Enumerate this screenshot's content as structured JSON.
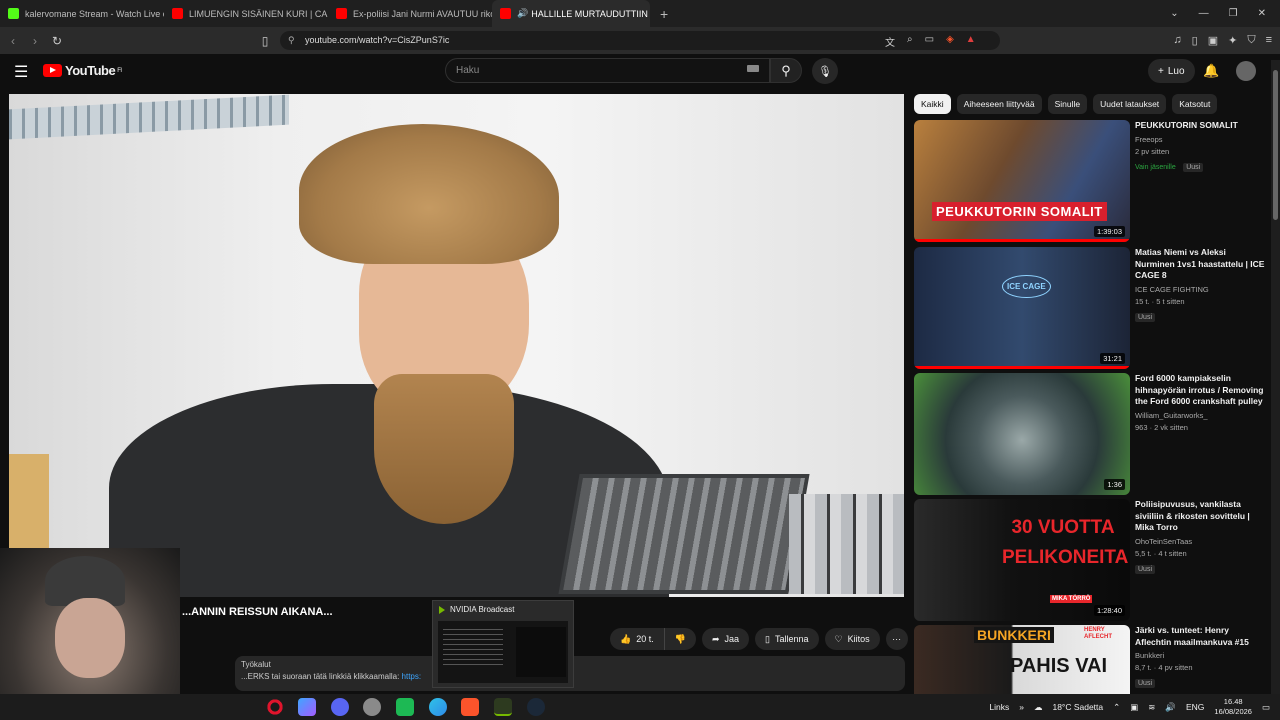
{
  "browser": {
    "tabs": [
      {
        "title": "kalervomane Stream - Watch Live on",
        "color": "#53fc18"
      },
      {
        "title": "LIMUENGIN SISÄINEN KURI | CANNO",
        "color": "#ff0000"
      },
      {
        "title": "Ex-poliisi Jani Nurmi AVAUTUU rikolli",
        "color": "#ff0000"
      },
      {
        "title": "HALLILLE MURTAUDUTTIIN ...",
        "color": "#ff0000",
        "active": true
      }
    ],
    "new_tab": "+",
    "url": "youtube.com/watch?v=CisZPunS7ic"
  },
  "youtube": {
    "logo_text": "YouTube",
    "logo_sup": "FI",
    "search_placeholder": "Haku",
    "create_label": "Luo",
    "video_title": "...ANNIN REISSUN AIKANA...",
    "actions": {
      "likes": "20 t.",
      "share": "Jaa",
      "save": "Tallenna",
      "thanks": "Kiitos",
      "more": "···"
    },
    "description_line1": "Työkalut",
    "description_line2": "...ERKS tai suoraan tätä linkkiä klikkaamalla:",
    "description_link": "https:",
    "chips": [
      "Kaikki",
      "Aiheeseen liittyvää",
      "Sinulle",
      "Uudet lataukset",
      "Katsotut"
    ],
    "recommendations": [
      {
        "title": "PEUKKUTORIN SOMALIT",
        "channel": "Freeops",
        "stats": "2 pv sitten",
        "badges": [
          "Vain jäsenille",
          "Uusi"
        ],
        "duration": "1:39:03",
        "thumb_caption": "PEUKKUTORIN SOMALIT",
        "progress": 1.0
      },
      {
        "title": "Matias Niemi vs Aleksi Nurminen 1vs1 haastattelu | ICE CAGE 8",
        "channel": "ICE CAGE FIGHTING",
        "stats": "15 t. · 5 t sitten",
        "badges": [
          "Uusi"
        ],
        "duration": "31:21",
        "thumb_caption": "ICE CAGE",
        "progress": 1.0
      },
      {
        "title": "Ford 6000 kampiakselin hihnapyörän irrotus / Removing the Ford 6000 crankshaft pulley",
        "channel": "William_Guitarworks_",
        "stats": "963 · 2 vk sitten",
        "badges": [],
        "duration": "1:36",
        "thumb_caption": "",
        "progress": 0
      },
      {
        "title": "Poliisipuvusus, vankilasta siviiliin & rikosten sovittelu | Mika Torro",
        "channel": "OhoTeinSenTaas",
        "stats": "5,5 t. · 4 t sitten",
        "badges": [
          "Uusi"
        ],
        "duration": "1:28:40",
        "thumb_caption": "30 VUOTTA PELIKONEITA",
        "thumb_sub": "MIKA TÖRRÖ",
        "progress": 0
      },
      {
        "title": "Järki vs. tunteet: Henry Aflechtin maailmankuva #15",
        "channel": "Bunkkeri",
        "stats": "8,7 t. · 4 pv sitten",
        "badges": [
          "Uusi"
        ],
        "duration": "",
        "thumb_caption": "BUNKKERI",
        "thumb_sub": "PAHIS VAI",
        "thumb_name": "HENRY AFLECHT",
        "progress": 0
      }
    ]
  },
  "nvidia": {
    "title": "NVIDIA Broadcast"
  },
  "taskbar": {
    "links": "Links",
    "weather": "18°C Sadetta",
    "lang": "ENG",
    "time": "16.48",
    "date": "16/08/2026"
  }
}
